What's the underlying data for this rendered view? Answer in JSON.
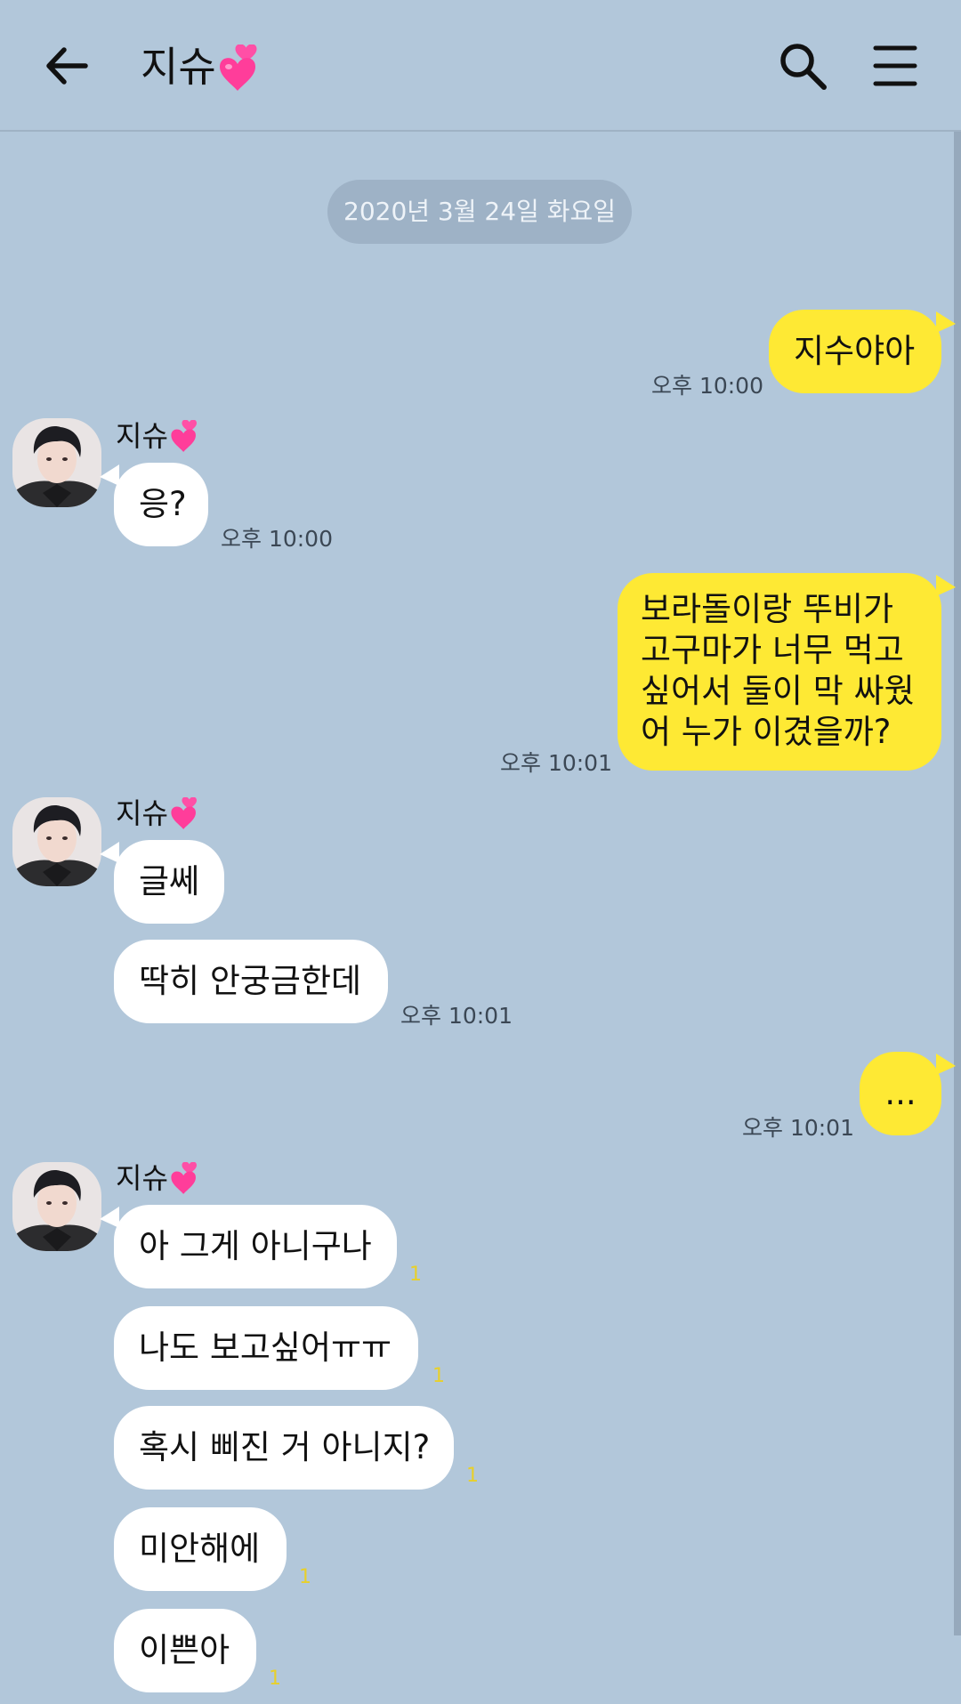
{
  "header": {
    "title": "지슈",
    "back_icon": "arrow-left-icon",
    "search_icon": "search-icon",
    "menu_icon": "hamburger-menu-icon"
  },
  "date_divider": "2020년 3월 24일 화요일",
  "contact": {
    "name": "지슈"
  },
  "colors": {
    "background": "#b2c7da",
    "outgoing_bubble": "#fee934",
    "incoming_bubble": "#ffffff",
    "heart": "#ff3d9a",
    "unread": "#e8d02a"
  },
  "messages": [
    {
      "id": "m1",
      "direction": "out",
      "text": "지수야아",
      "time": "오후 10:00"
    },
    {
      "id": "m2",
      "direction": "in",
      "text": "응?",
      "time": "오후 10:00"
    },
    {
      "id": "m3",
      "direction": "out",
      "lines": [
        "보라돌이랑 뚜비가",
        "고구마가 너무 먹고",
        "싶어서 둘이 막 싸웠",
        "어 누가 이겼을까?"
      ],
      "time": "오후 10:01"
    },
    {
      "id": "m4",
      "direction": "in",
      "text": "글쎄"
    },
    {
      "id": "m5",
      "direction": "in",
      "text": "딱히 안궁금한데",
      "time": "오후 10:01"
    },
    {
      "id": "m6",
      "direction": "out",
      "text": "...",
      "time": "오후 10:01"
    },
    {
      "id": "m7",
      "direction": "in",
      "text": "아 그게 아니구나",
      "unread": "1"
    },
    {
      "id": "m8",
      "direction": "in",
      "text": "나도 보고싶어ㅠㅠ",
      "unread": "1"
    },
    {
      "id": "m9",
      "direction": "in",
      "text": "혹시 삐진 거 아니지?",
      "unread": "1"
    },
    {
      "id": "m10",
      "direction": "in",
      "text": "미안해에",
      "unread": "1"
    },
    {
      "id": "m11",
      "direction": "in",
      "text": "이쁜아",
      "unread": "1"
    }
  ]
}
